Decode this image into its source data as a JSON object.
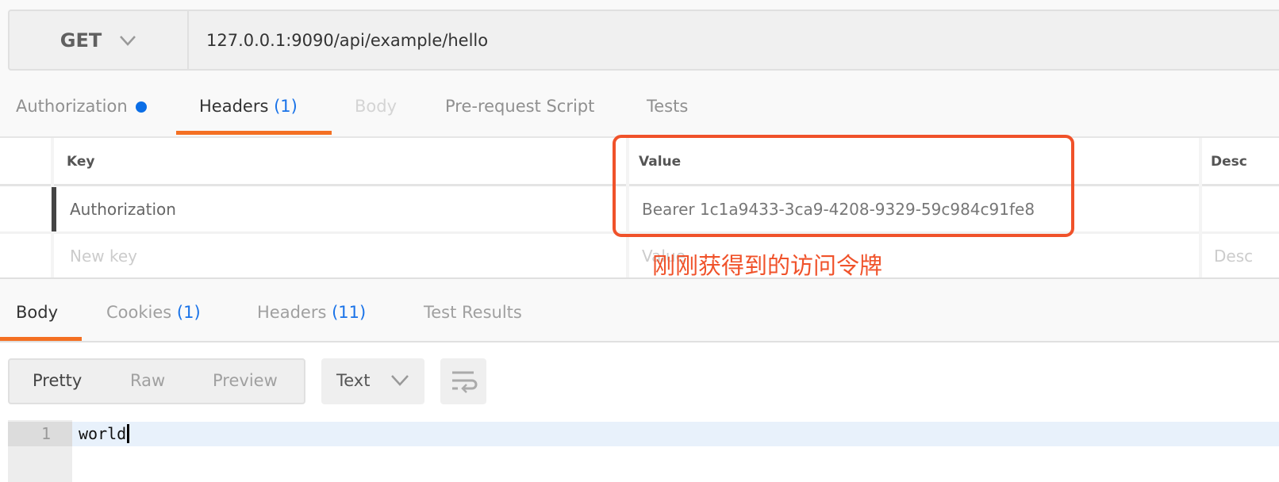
{
  "request": {
    "method": "GET",
    "url": "127.0.0.1:9090/api/example/hello"
  },
  "request_tabs": [
    {
      "label": "Authorization",
      "has_dot": true
    },
    {
      "label": "Headers",
      "count": "(1)",
      "active": true
    },
    {
      "label": "Body",
      "disabled": true
    },
    {
      "label": "Pre-request Script"
    },
    {
      "label": "Tests"
    }
  ],
  "headers_table": {
    "columns": [
      "Key",
      "Value",
      "Desc"
    ],
    "rows": [
      {
        "key": "Authorization",
        "value": "Bearer 1c1a9433-3ca9-4208-9329-59c984c91fe8"
      }
    ],
    "placeholders": {
      "key": "New key",
      "value": "Value",
      "description": "Desc"
    }
  },
  "annotation": {
    "text": "刚刚获得到的访问令牌",
    "color": "#f0522a"
  },
  "response_tabs": [
    {
      "label": "Body",
      "active": true
    },
    {
      "label": "Cookies",
      "count": "(1)"
    },
    {
      "label": "Headers",
      "count": "(11)"
    },
    {
      "label": "Test Results"
    }
  ],
  "view_modes": {
    "pretty": "Pretty",
    "raw": "Raw",
    "preview": "Preview",
    "selected": "Pretty"
  },
  "format_select": "Text",
  "wrap_icon": "wrap-lines-icon",
  "editor": {
    "lines": [
      {
        "number": "1",
        "text": "world"
      }
    ]
  },
  "colors": {
    "accent": "#f47023",
    "count_blue": "#1a73e8"
  }
}
